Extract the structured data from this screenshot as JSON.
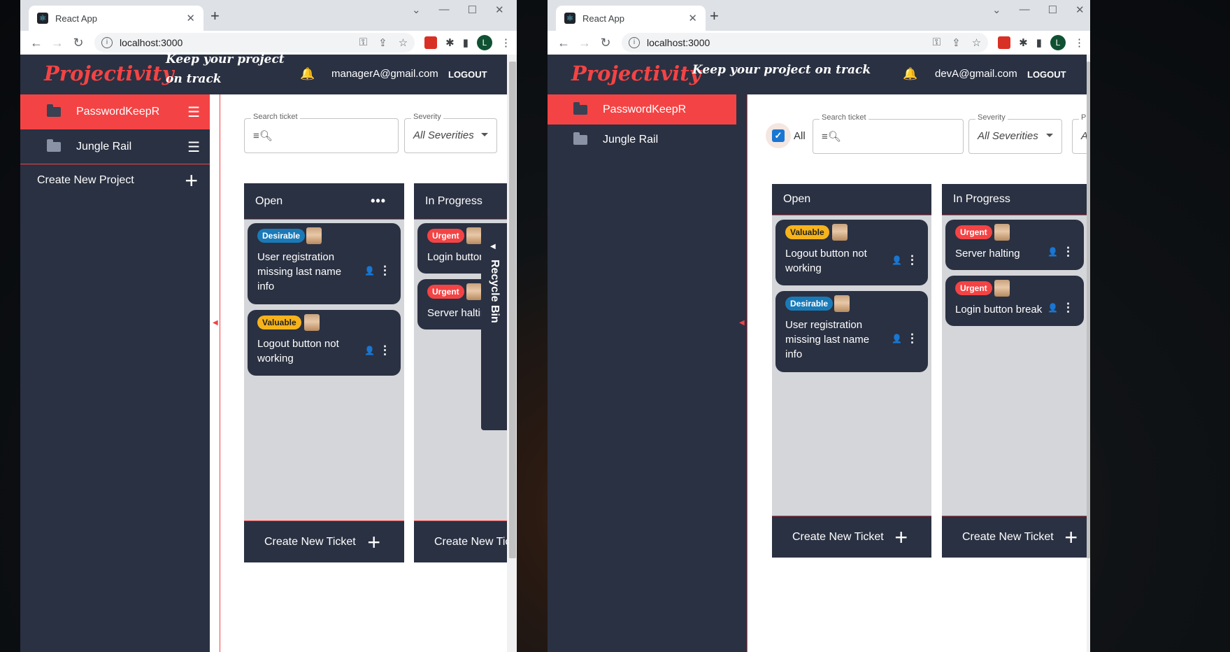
{
  "left": {
    "tab_title": "React App",
    "url": "localhost:3000",
    "profile_initial": "L",
    "app": {
      "logo": "Projectivity",
      "tagline_line1": "Keep your project",
      "tagline_line2": "on track",
      "user_email": "managerA@gmail.com",
      "logout_label": "LOGOUT"
    },
    "sidebar": {
      "projects": [
        {
          "name": "PasswordKeepR",
          "active": true
        },
        {
          "name": "Jungle Rail",
          "active": false
        }
      ],
      "create_project_label": "Create New Project"
    },
    "filters": {
      "search_label": "Search ticket",
      "severity_label": "Severity",
      "severity_value": "All Severities"
    },
    "columns": [
      {
        "title": "Open",
        "tickets": [
          {
            "badge": "Desirable",
            "title_lines": [
              "User registration",
              "missing last name",
              "info"
            ]
          },
          {
            "badge": "Valuable",
            "title_lines": [
              "Logout button not",
              "working"
            ]
          }
        ],
        "create_label": "Create New Ticket"
      },
      {
        "title": "In Progress",
        "tickets": [
          {
            "badge": "Urgent",
            "title_lines": [
              "Login button"
            ]
          },
          {
            "badge": "Urgent",
            "title_lines": [
              "Server haltin"
            ]
          }
        ],
        "create_label": "Create New Tick"
      }
    ],
    "recycle_bin_label": "Recycle Bin"
  },
  "right": {
    "tab_title": "React App",
    "url": "localhost:3000",
    "profile_initial": "L",
    "app": {
      "logo": "Projectivity",
      "tagline": "Keep your project on track",
      "user_email": "devA@gmail.com",
      "logout_label": "LOGOUT"
    },
    "sidebar": {
      "projects": [
        {
          "name": "PasswordKeepR",
          "active": true
        },
        {
          "name": "Jungle Rail",
          "active": false
        }
      ]
    },
    "filters": {
      "all_label": "All",
      "all_checked": true,
      "search_label": "Search ticket",
      "severity_label": "Severity",
      "severity_value": "All Severities",
      "third_label_partial": "Pr",
      "third_value_partial": "A"
    },
    "columns": [
      {
        "title": "Open",
        "tickets": [
          {
            "badge": "Valuable",
            "title_lines": [
              "Logout button not",
              "working"
            ]
          },
          {
            "badge": "Desirable",
            "title_lines": [
              "User registration",
              "missing last name",
              "info"
            ]
          }
        ],
        "create_label": "Create New Ticket"
      },
      {
        "title": "In Progress",
        "tickets": [
          {
            "badge": "Urgent",
            "title_lines": [
              "Server halting"
            ]
          },
          {
            "badge": "Urgent",
            "title_lines": [
              "Login button break"
            ]
          }
        ],
        "create_label": "Create New Ticket"
      }
    ]
  },
  "colors": {
    "brand_red": "#f44344",
    "navy": "#2a3142",
    "column_bg": "#d5d6da",
    "urgent": "#f44344",
    "valuable": "#f7b31b",
    "desirable": "#1a7ab8"
  },
  "icons": {
    "bell": "bell-icon",
    "folder": "folder-icon",
    "menu": "hamburger-icon",
    "plus": "plus-icon",
    "search": "search-icon",
    "assign": "assign-user-icon",
    "more": "more-vert-icon"
  }
}
